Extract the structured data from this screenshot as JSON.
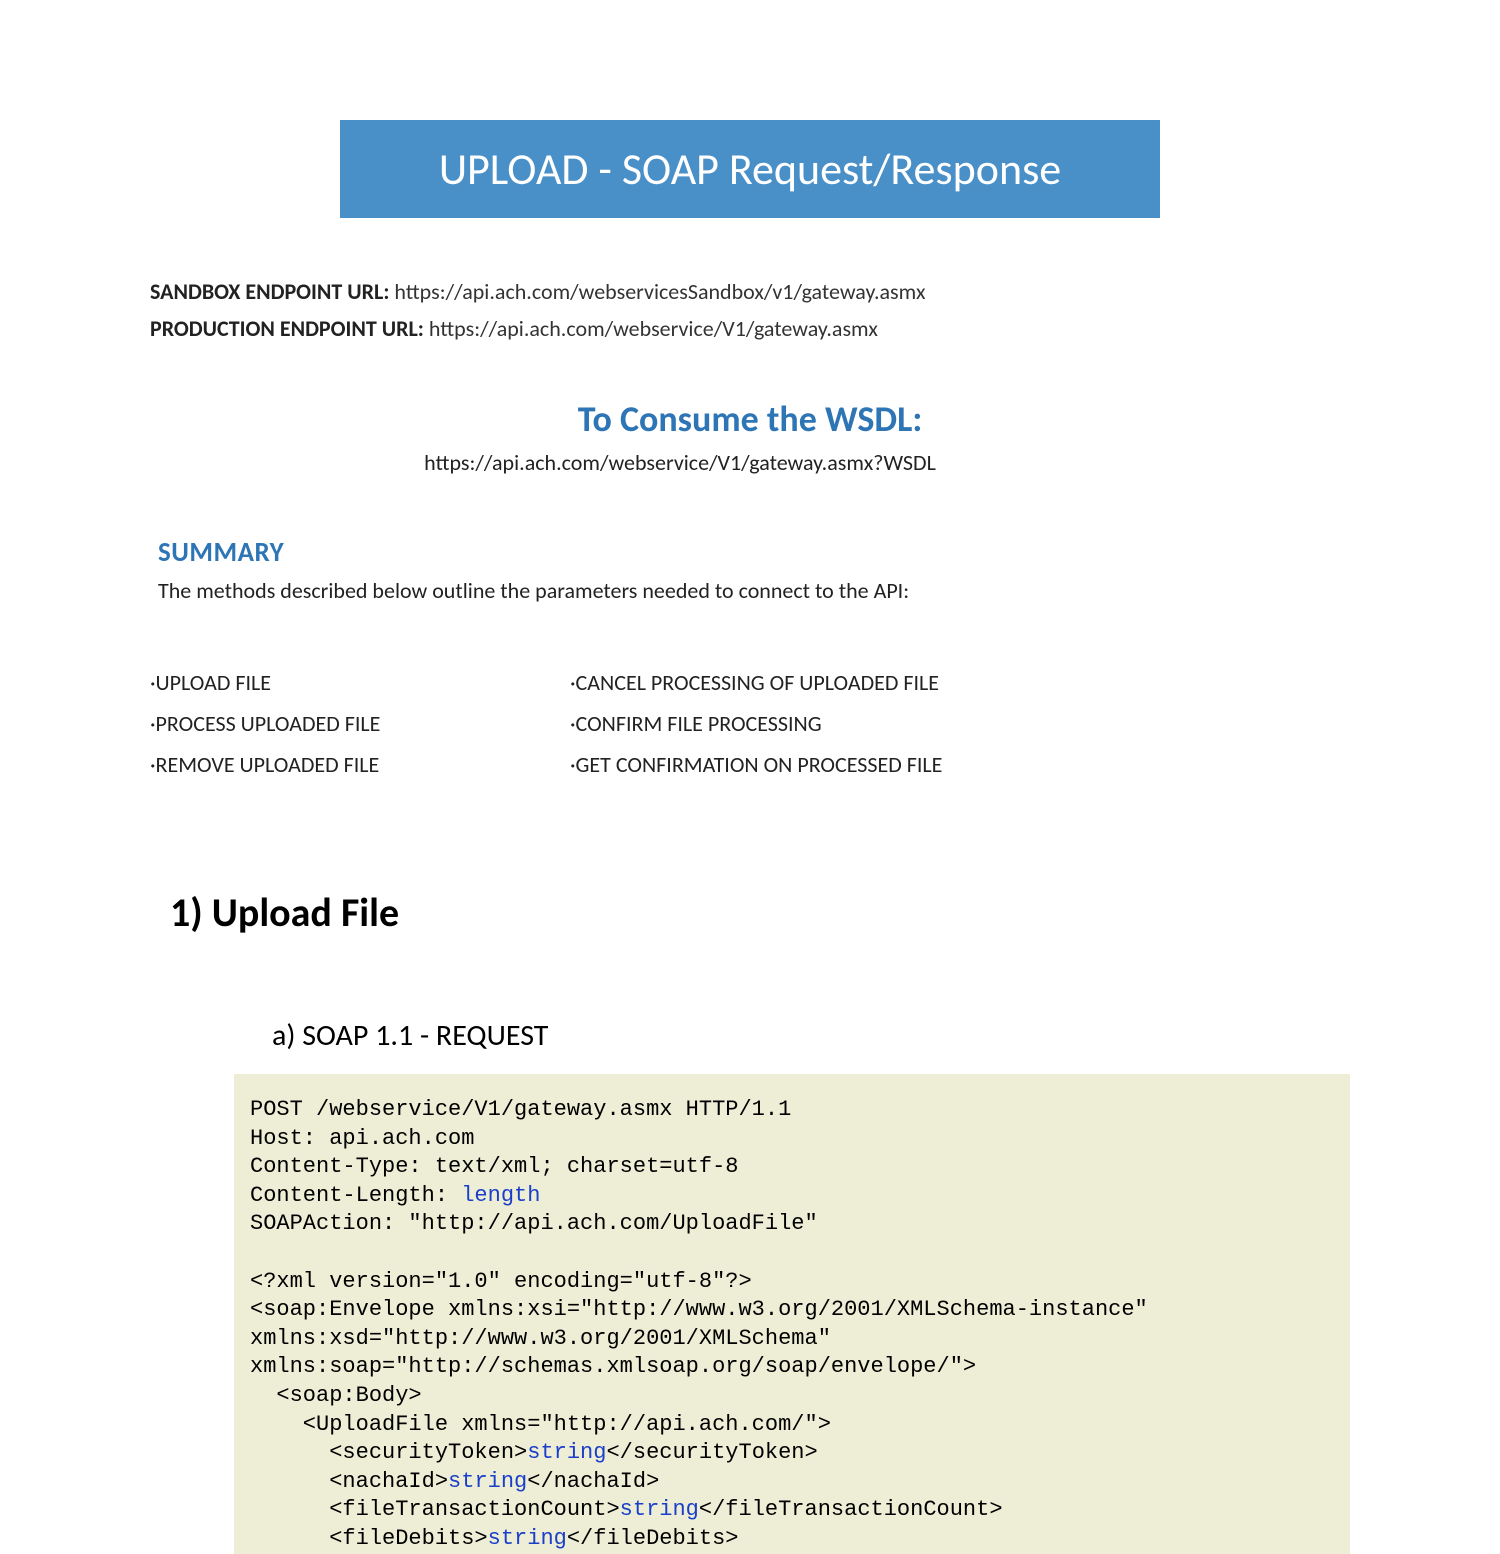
{
  "banner": "UPLOAD - SOAP Request/Response",
  "endpoints": {
    "sandboxLabel": "SANDBOX ENDPOINT URL:",
    "sandboxValue": " https://api.ach.com/webservicesSandbox/v1/gateway.asmx",
    "productionLabel": "PRODUCTION ENDPOINT URL:",
    "productionValue": " https://api.ach.com/webservice/V1/gateway.asmx"
  },
  "wsdl": {
    "heading": "To Consume the WSDL:",
    "url": "https://api.ach.com/webservice/V1/gateway.asmx?WSDL"
  },
  "summary": {
    "heading": "SUMMARY",
    "text": "The methods described below outline the parameters needed to connect to the API:"
  },
  "methods": {
    "col1": [
      "·UPLOAD FILE",
      "·PROCESS UPLOADED FILE",
      "·REMOVE UPLOADED FILE"
    ],
    "col2": [
      "·CANCEL PROCESSING OF UPLOADED FILE",
      "·CONFIRM FILE PROCESSING",
      "·GET CONFIRMATION ON PROCESSED FILE"
    ]
  },
  "section1": {
    "title": "1) Upload File",
    "subA": "a)  SOAP 1.1 - REQUEST"
  },
  "code": {
    "l1": "POST /webservice/V1/gateway.asmx HTTP/1.1",
    "l2": "Host: api.ach.com",
    "l3": "Content-Type: text/xml; charset=utf-8",
    "l4a": "Content-Length: ",
    "l4b": "length",
    "l5": "SOAPAction: \"http://api.ach.com/UploadFile\"",
    "l6": "",
    "l7": "<?xml version=\"1.0\" encoding=\"utf-8\"?>",
    "l8": "<soap:Envelope xmlns:xsi=\"http://www.w3.org/2001/XMLSchema-instance\" ",
    "l9": "xmlns:xsd=\"http://www.w3.org/2001/XMLSchema\" ",
    "l10": "xmlns:soap=\"http://schemas.xmlsoap.org/soap/envelope/\">",
    "l11": "  <soap:Body>",
    "l12": "    <UploadFile xmlns=\"http://api.ach.com/\">",
    "l13a": "      <securityToken>",
    "l13b": "string",
    "l13c": "</securityToken>",
    "l14a": "      <nachaId>",
    "l14b": "string",
    "l14c": "</nachaId>",
    "l15a": "      <fileTransactionCount>",
    "l15b": "string",
    "l15c": "</fileTransactionCount>",
    "l16a": "      <fileDebits>",
    "l16b": "string",
    "l16c": "</fileDebits>"
  }
}
